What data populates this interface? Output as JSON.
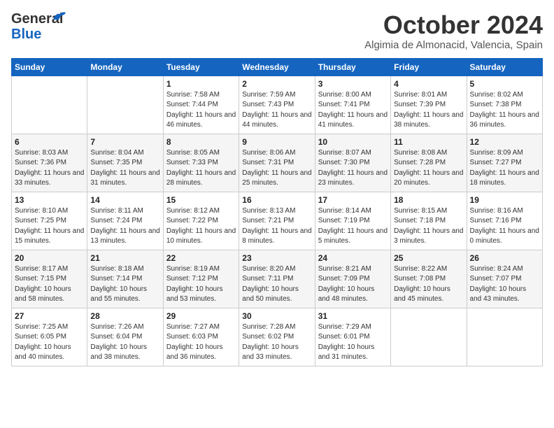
{
  "header": {
    "logo_line1": "General",
    "logo_line2": "Blue",
    "month": "October 2024",
    "location": "Algimia de Almonacid, Valencia, Spain"
  },
  "weekdays": [
    "Sunday",
    "Monday",
    "Tuesday",
    "Wednesday",
    "Thursday",
    "Friday",
    "Saturday"
  ],
  "weeks": [
    [
      {
        "day": "",
        "info": ""
      },
      {
        "day": "",
        "info": ""
      },
      {
        "day": "1",
        "info": "Sunrise: 7:58 AM\nSunset: 7:44 PM\nDaylight: 11 hours and 46 minutes."
      },
      {
        "day": "2",
        "info": "Sunrise: 7:59 AM\nSunset: 7:43 PM\nDaylight: 11 hours and 44 minutes."
      },
      {
        "day": "3",
        "info": "Sunrise: 8:00 AM\nSunset: 7:41 PM\nDaylight: 11 hours and 41 minutes."
      },
      {
        "day": "4",
        "info": "Sunrise: 8:01 AM\nSunset: 7:39 PM\nDaylight: 11 hours and 38 minutes."
      },
      {
        "day": "5",
        "info": "Sunrise: 8:02 AM\nSunset: 7:38 PM\nDaylight: 11 hours and 36 minutes."
      }
    ],
    [
      {
        "day": "6",
        "info": "Sunrise: 8:03 AM\nSunset: 7:36 PM\nDaylight: 11 hours and 33 minutes."
      },
      {
        "day": "7",
        "info": "Sunrise: 8:04 AM\nSunset: 7:35 PM\nDaylight: 11 hours and 31 minutes."
      },
      {
        "day": "8",
        "info": "Sunrise: 8:05 AM\nSunset: 7:33 PM\nDaylight: 11 hours and 28 minutes."
      },
      {
        "day": "9",
        "info": "Sunrise: 8:06 AM\nSunset: 7:31 PM\nDaylight: 11 hours and 25 minutes."
      },
      {
        "day": "10",
        "info": "Sunrise: 8:07 AM\nSunset: 7:30 PM\nDaylight: 11 hours and 23 minutes."
      },
      {
        "day": "11",
        "info": "Sunrise: 8:08 AM\nSunset: 7:28 PM\nDaylight: 11 hours and 20 minutes."
      },
      {
        "day": "12",
        "info": "Sunrise: 8:09 AM\nSunset: 7:27 PM\nDaylight: 11 hours and 18 minutes."
      }
    ],
    [
      {
        "day": "13",
        "info": "Sunrise: 8:10 AM\nSunset: 7:25 PM\nDaylight: 11 hours and 15 minutes."
      },
      {
        "day": "14",
        "info": "Sunrise: 8:11 AM\nSunset: 7:24 PM\nDaylight: 11 hours and 13 minutes."
      },
      {
        "day": "15",
        "info": "Sunrise: 8:12 AM\nSunset: 7:22 PM\nDaylight: 11 hours and 10 minutes."
      },
      {
        "day": "16",
        "info": "Sunrise: 8:13 AM\nSunset: 7:21 PM\nDaylight: 11 hours and 8 minutes."
      },
      {
        "day": "17",
        "info": "Sunrise: 8:14 AM\nSunset: 7:19 PM\nDaylight: 11 hours and 5 minutes."
      },
      {
        "day": "18",
        "info": "Sunrise: 8:15 AM\nSunset: 7:18 PM\nDaylight: 11 hours and 3 minutes."
      },
      {
        "day": "19",
        "info": "Sunrise: 8:16 AM\nSunset: 7:16 PM\nDaylight: 11 hours and 0 minutes."
      }
    ],
    [
      {
        "day": "20",
        "info": "Sunrise: 8:17 AM\nSunset: 7:15 PM\nDaylight: 10 hours and 58 minutes."
      },
      {
        "day": "21",
        "info": "Sunrise: 8:18 AM\nSunset: 7:14 PM\nDaylight: 10 hours and 55 minutes."
      },
      {
        "day": "22",
        "info": "Sunrise: 8:19 AM\nSunset: 7:12 PM\nDaylight: 10 hours and 53 minutes."
      },
      {
        "day": "23",
        "info": "Sunrise: 8:20 AM\nSunset: 7:11 PM\nDaylight: 10 hours and 50 minutes."
      },
      {
        "day": "24",
        "info": "Sunrise: 8:21 AM\nSunset: 7:09 PM\nDaylight: 10 hours and 48 minutes."
      },
      {
        "day": "25",
        "info": "Sunrise: 8:22 AM\nSunset: 7:08 PM\nDaylight: 10 hours and 45 minutes."
      },
      {
        "day": "26",
        "info": "Sunrise: 8:24 AM\nSunset: 7:07 PM\nDaylight: 10 hours and 43 minutes."
      }
    ],
    [
      {
        "day": "27",
        "info": "Sunrise: 7:25 AM\nSunset: 6:05 PM\nDaylight: 10 hours and 40 minutes."
      },
      {
        "day": "28",
        "info": "Sunrise: 7:26 AM\nSunset: 6:04 PM\nDaylight: 10 hours and 38 minutes."
      },
      {
        "day": "29",
        "info": "Sunrise: 7:27 AM\nSunset: 6:03 PM\nDaylight: 10 hours and 36 minutes."
      },
      {
        "day": "30",
        "info": "Sunrise: 7:28 AM\nSunset: 6:02 PM\nDaylight: 10 hours and 33 minutes."
      },
      {
        "day": "31",
        "info": "Sunrise: 7:29 AM\nSunset: 6:01 PM\nDaylight: 10 hours and 31 minutes."
      },
      {
        "day": "",
        "info": ""
      },
      {
        "day": "",
        "info": ""
      }
    ]
  ]
}
